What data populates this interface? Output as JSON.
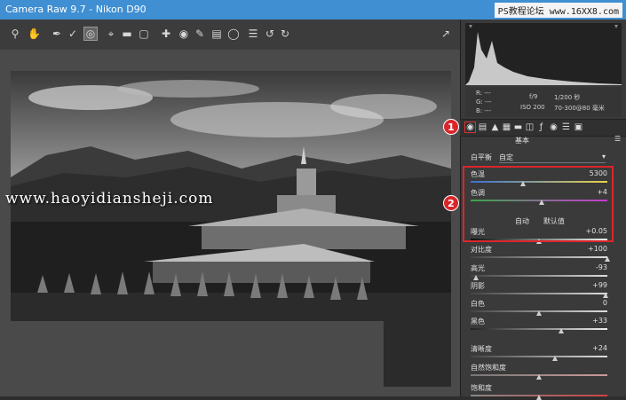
{
  "window": {
    "title": "Camera Raw 9.7 -  Nikon D90",
    "watermark": "PS教程论坛 www.16XX8.com"
  },
  "toolbar": {
    "tools": [
      "zoom-icon",
      "hand-icon",
      "white-balance-icon",
      "color-sampler-icon",
      "targeted-adjust-icon",
      "crop-icon",
      "straighten-icon",
      "transform-icon",
      "spot-removal-icon",
      "red-eye-icon",
      "adjustment-brush-icon",
      "graduated-filter-icon",
      "radial-filter-icon",
      "presets-icon",
      "rotate-ccw-icon",
      "rotate-cw-icon",
      "open-preferences-icon"
    ]
  },
  "photo": {
    "overlay_url": "www.haoyidiansheji.com"
  },
  "info": {
    "r": "R:  ---",
    "g": "G:  ---",
    "b": "B:  ---",
    "aperture": "f/9",
    "shutter": "1/200 秒",
    "iso": "ISO 200",
    "lens": "70-300@80 毫米"
  },
  "panel": {
    "section_title": "基本",
    "white_balance_label": "白平衡",
    "white_balance_value": "自定",
    "auto_label": "自动",
    "default_label": "默认值"
  },
  "sliders": [
    {
      "label": "色温",
      "value": "5300",
      "level": 0.38
    },
    {
      "label": "色调",
      "value": "+4",
      "level": 0.52
    },
    {
      "label": "曝光",
      "value": "+0.05",
      "level": 0.5
    },
    {
      "label": "对比度",
      "value": "+100",
      "level": 1.0
    },
    {
      "label": "高光",
      "value": "-93",
      "level": 0.04
    },
    {
      "label": "阴影",
      "value": "+99",
      "level": 0.99
    },
    {
      "label": "白色",
      "value": "0",
      "level": 0.5
    },
    {
      "label": "黑色",
      "value": "+33",
      "level": 0.66
    },
    {
      "label": "清晰度",
      "value": "+24",
      "level": 0.62
    },
    {
      "label": "自然饱和度",
      "value": "",
      "level": 0.5
    },
    {
      "label": "饱和度",
      "value": "",
      "level": 0.5
    }
  ],
  "badges": {
    "one": "1",
    "two": "2"
  },
  "colors": {
    "titlebar": "#3f8fd2",
    "highlight": "#d9262b"
  }
}
